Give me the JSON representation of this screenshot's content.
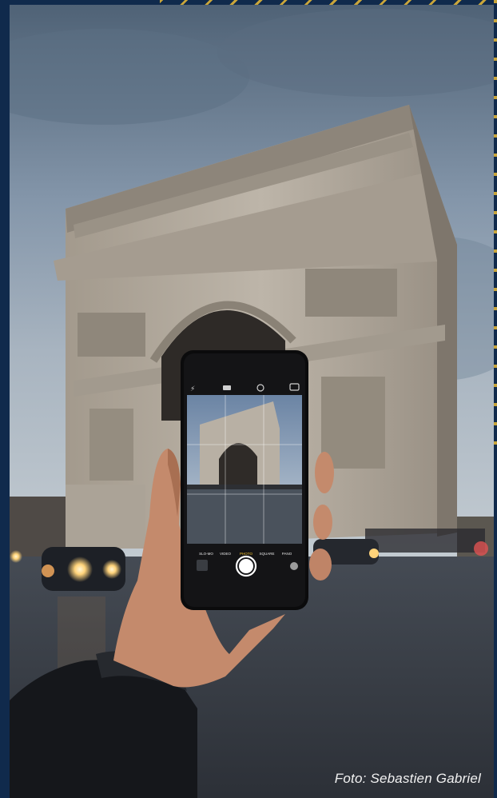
{
  "caption": "Foto: Sebastien Gabriel",
  "colors": {
    "frame": "#102a4c",
    "accent": "#c9a53a",
    "sky": "#8fa0b2",
    "stone": "#b8b0a4",
    "road": "#3a3f47"
  },
  "phone": {
    "camera_modes": [
      "SLO-MO",
      "VIDEO",
      "PHOTO",
      "SQUARE",
      "PANO"
    ],
    "selected_mode": "PHOTO",
    "icons": [
      "flash-off-icon",
      "hdr-icon",
      "timer-icon",
      "camera-flip-icon",
      "shutter-button",
      "thumbnail"
    ]
  }
}
